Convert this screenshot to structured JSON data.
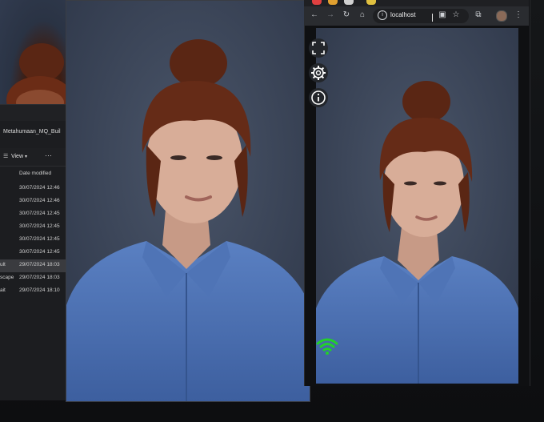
{
  "explorer": {
    "title": "Metahumaan_MQ_Buil",
    "view_label": "View",
    "more_label": "···",
    "column_header": "Date modified",
    "rows": [
      {
        "name": "",
        "date": "30/07/2024 12:46",
        "selected": false
      },
      {
        "name": "",
        "date": "30/07/2024 12:46",
        "selected": false
      },
      {
        "name": "",
        "date": "30/07/2024 12:45",
        "selected": false
      },
      {
        "name": "",
        "date": "30/07/2024 12:45",
        "selected": false
      },
      {
        "name": "",
        "date": "30/07/2024 12:45",
        "selected": false
      },
      {
        "name": "",
        "date": "30/07/2024 12:45",
        "selected": false
      },
      {
        "name": "ult",
        "date": "29/07/2024 18:03",
        "selected": true
      },
      {
        "name": "scape",
        "date": "29/07/2024 18:03",
        "selected": false
      },
      {
        "name": "ait",
        "date": "29/07/2024 18:10",
        "selected": false
      }
    ]
  },
  "browser": {
    "url": "localhost",
    "tab_colors": [
      "#e04040",
      "#e0a030",
      "#d0d0d0",
      "#e0c040"
    ]
  },
  "viewer_controls": {
    "fullscreen_icon": "fullscreen-icon",
    "settings_icon": "gear-icon",
    "info_icon": "info-icon",
    "signal_icon": "wifi-icon",
    "signal_color": "#22d02a"
  },
  "colors": {
    "backdrop": "#3b4658",
    "shirt": "#4a6fb0",
    "hair": "#5a2614"
  }
}
